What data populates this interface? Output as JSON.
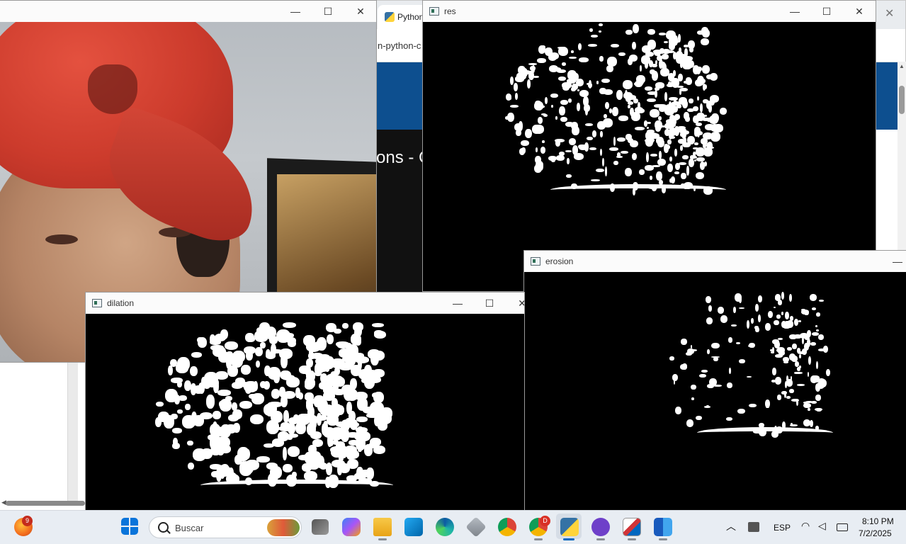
{
  "browser": {
    "tab_title": "Python P",
    "url_fragment": "n-python-c",
    "heading_fragment": "ons - C",
    "menu_icon": "kebab-menu-icon",
    "close_icon": "close-icon"
  },
  "windows": {
    "camera": {
      "title": ""
    },
    "res": {
      "title": "res"
    },
    "dilation": {
      "title": "dilation"
    },
    "erosion": {
      "title": "erosion"
    }
  },
  "window_controls": {
    "minimize": "—",
    "maximize": "☐",
    "close": "✕"
  },
  "taskbar": {
    "search_placeholder": "Buscar",
    "pinned": [
      {
        "name": "firefox",
        "badge": "9"
      },
      {
        "name": "start"
      },
      {
        "name": "task-view"
      },
      {
        "name": "copilot"
      },
      {
        "name": "file-explorer"
      },
      {
        "name": "vscode"
      },
      {
        "name": "edge"
      },
      {
        "name": "virtualbox"
      },
      {
        "name": "chrome"
      },
      {
        "name": "chrome-profile",
        "badge": "D"
      },
      {
        "name": "python"
      },
      {
        "name": "github-desktop"
      },
      {
        "name": "snipping-tool"
      },
      {
        "name": "word"
      }
    ],
    "tray": {
      "language": "ESP",
      "time": "8:10 PM",
      "date": "7/2/2025"
    }
  },
  "colors": {
    "accent": "#0067c0",
    "mask_fg": "#ffffff",
    "mask_bg": "#000000"
  }
}
